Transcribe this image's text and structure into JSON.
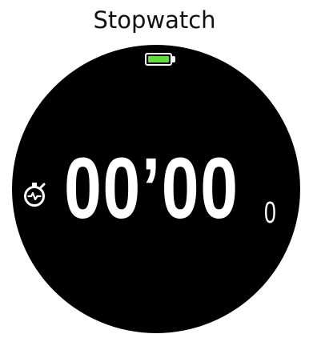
{
  "app": {
    "title": "Stopwatch"
  },
  "status": {
    "battery_level": 1.0,
    "battery_color": "#62dc3a"
  },
  "stopwatch": {
    "icon": "stopwatch-icon",
    "elapsed_main": "00’00",
    "elapsed_tenths": "0"
  }
}
